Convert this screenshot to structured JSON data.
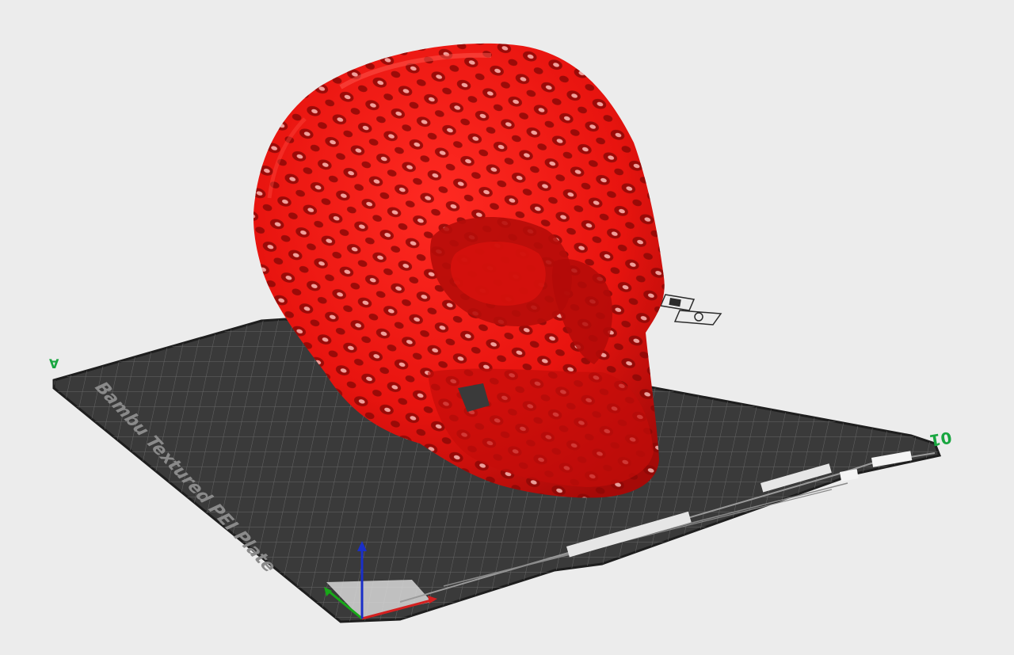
{
  "viewport": {
    "background": "#ececec",
    "plate": {
      "name": "Bambu Textured PEI Plate",
      "number": "01",
      "corner_mark": "∀",
      "color": "#3a3a3a",
      "grid_color": "#6b6b6b",
      "edge_color": "#1e1e1e"
    },
    "model": {
      "name": "skull",
      "color": "#e8140f",
      "shade_color": "#a50a08",
      "hole_color": "#f3b7b3"
    },
    "axes": {
      "x_color": "#d42020",
      "y_color": "#18a818",
      "z_color": "#1a2fc8"
    },
    "plate_icons": [
      "plate-settings-icon",
      "plate-arrange-icon"
    ]
  }
}
